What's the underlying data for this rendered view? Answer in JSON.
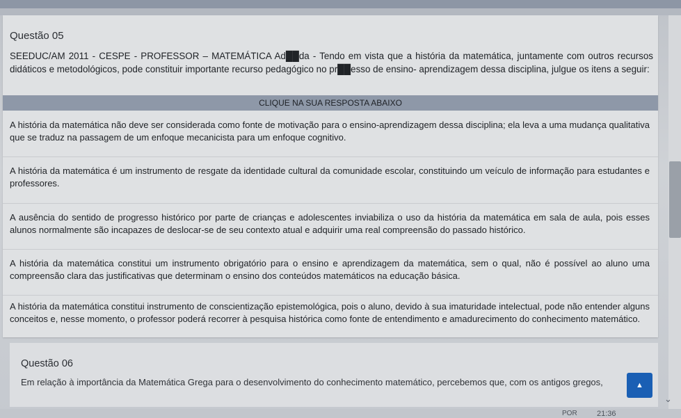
{
  "question5": {
    "title": "Questão 05",
    "text": "SEEDUC/AM 2011 - CESPE - PROFESSOR – MATEMÁTICA Ad██da - Tendo em vista que a história da matemática, juntamente com outros recursos didáticos e metodológicos, pode constituir importante recurso pedagógico no pr██esso de ensino- aprendizagem dessa disciplina, julgue os itens a seguir:",
    "answer_header": "CLIQUE NA SUA RESPOSTA ABAIXO",
    "options": [
      "A história da matemática não deve ser considerada como fonte de motivação para o ensino-aprendizagem dessa disciplina; ela leva a uma mudança qualitativa que se traduz na passagem de um enfoque mecanicista para um enfoque cognitivo.",
      "A história da matemática é um instrumento de resgate da identidade cultural da comunidade escolar, constituindo um veículo de informação para estudantes e professores.",
      "A ausência do sentido de progresso histórico por parte de crianças e adolescentes inviabiliza o uso da história da matemática em sala de aula, pois esses alunos normalmente são incapazes de deslocar-se de seu contexto atual e adquirir uma real compreensão do passado histórico.",
      "A história da matemática constitui um instrumento obrigatório para o ensino e aprendizagem da matemática, sem o qual, não é possível ao aluno uma compreensão clara das justificativas que determinam o ensino dos conteúdos matemáticos na educação básica.",
      "A história da matemática constitui instrumento de conscientização epistemológica, pois o aluno, devido à sua imaturidade intelectual, pode não entender alguns conceitos e, nesse momento, o professor poderá recorrer à pesquisa histórica como fonte de entendimento e amadurecimento do conhecimento matemático."
    ]
  },
  "question6": {
    "title": "Questão 06",
    "text": "Em relação à importância da Matemática Grega para o desenvolvimento do conhecimento matemático, percebemos que, com os antigos gregos,"
  },
  "scroll_top_icon": "caret-up-icon",
  "taskbar": {
    "lang": "POR",
    "clock": "21:36"
  },
  "colors": {
    "accent": "#1a5fb4",
    "header_bar": "#8e98a8"
  }
}
